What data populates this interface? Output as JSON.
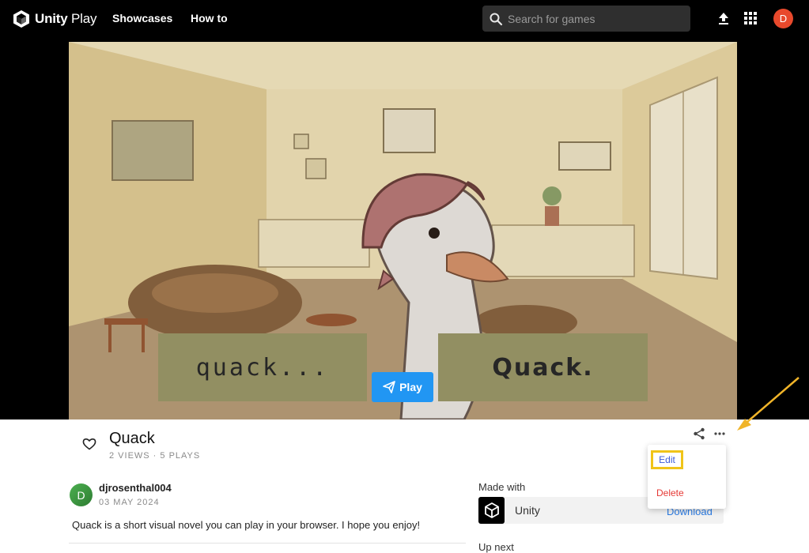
{
  "topbar": {
    "logo_bold": "Unity",
    "logo_light": " Play",
    "nav": [
      "Showcases",
      "How to"
    ],
    "search_placeholder": "Search for games",
    "user_initial": "D"
  },
  "game": {
    "choices": [
      "quack...",
      "Quack."
    ],
    "play_label": "Play"
  },
  "info": {
    "title": "Quack",
    "stats": "2 VIEWS · 5 PLAYS",
    "author": {
      "initial": "D",
      "name": "djrosenthal004",
      "date": "03 MAY 2024"
    },
    "description": "Quack is a short visual novel you can play in your browser. I hope you enjoy!"
  },
  "sidebar": {
    "made_with_label": "Made with",
    "engine": "Unity",
    "download_label": "Download",
    "up_next_label": "Up next"
  },
  "menu": {
    "edit_label": "Edit",
    "delete_label": "Delete"
  },
  "colors": {
    "accent": "#2196f3",
    "highlight": "#f0c419",
    "avatar": "#e8492c",
    "danger": "#e53935"
  }
}
